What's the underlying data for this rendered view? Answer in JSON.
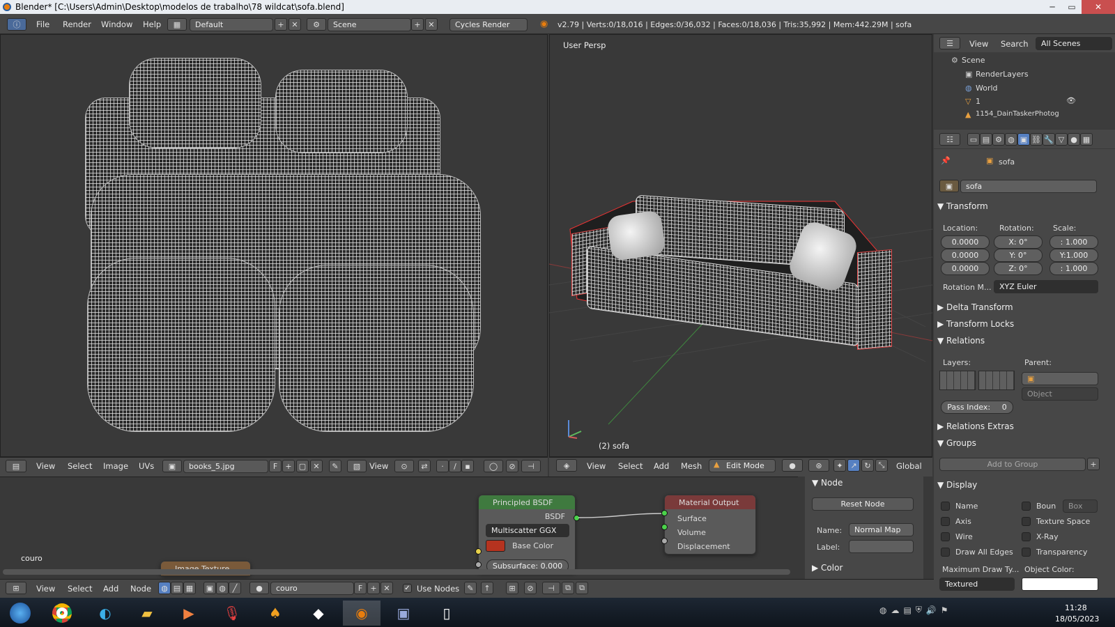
{
  "window": {
    "title": "Blender* [C:\\Users\\Admin\\Desktop\\modelos de trabalho\\78 wildcat\\sofa.blend]",
    "minimize": "─",
    "maximize": "▭",
    "close": "✕"
  },
  "menubar": {
    "items": [
      "File",
      "Render",
      "Window",
      "Help"
    ],
    "screen_layout": "Default",
    "scene": "Scene",
    "render_engine": "Cycles Render",
    "stats": "v2.79 | Verts:0/18,016 | Edges:0/36,032 | Faces:0/18,036 | Tris:35,992 | Mem:442.29M | sofa"
  },
  "uv_editor": {
    "menu": [
      "View",
      "Select",
      "Image",
      "UVs"
    ],
    "image_name": "books_5.jpg",
    "f_label": "F",
    "view_label": "View"
  },
  "viewport3d": {
    "view_name": "User Persp",
    "object_label": "(2) sofa",
    "menu": [
      "View",
      "Select",
      "Add",
      "Mesh"
    ],
    "mode": "Edit Mode",
    "orientation": "Global"
  },
  "outliner": {
    "menu": [
      "View",
      "Search"
    ],
    "filter": "All Scenes",
    "items": [
      "Scene",
      "RenderLayers",
      "World",
      "1",
      "1154_DainTaskerPhotog"
    ]
  },
  "properties": {
    "breadcrumb": "sofa",
    "object_name": "sofa",
    "transform": {
      "title": "Transform",
      "location_label": "Location:",
      "rotation_label": "Rotation:",
      "scale_label": "Scale:",
      "location": [
        "0.0000",
        "0.0000",
        "0.0000"
      ],
      "rotation": [
        "X:      0°",
        "Y:      0°",
        "Z:      0°"
      ],
      "scale": [
        ":  1.000",
        "Y:1.000",
        ":  1.000"
      ],
      "rotation_mode_label": "Rotation M...",
      "rotation_mode": "XYZ Euler"
    },
    "delta_transform": "Delta Transform",
    "transform_locks": "Transform Locks",
    "relations": {
      "title": "Relations",
      "layers_label": "Layers:",
      "parent_label": "Parent:",
      "parent_type": "Object",
      "pass_index_label": "Pass Index:",
      "pass_index": "0"
    },
    "relations_extras": "Relations Extras",
    "groups": {
      "title": "Groups",
      "add": "Add to Group"
    },
    "display": {
      "title": "Display",
      "left": [
        "Name",
        "Axis",
        "Wire",
        "Draw All Edges"
      ],
      "right": [
        "Boun",
        "Texture Space",
        "X-Ray",
        "Transparency"
      ],
      "bounds_type": "Box",
      "max_draw_label": "Maximum Draw Ty...",
      "max_draw": "Textured",
      "object_color_label": "Object Color:"
    }
  },
  "node_editor": {
    "material_label": "couro",
    "image_texture_node": "Image Texture",
    "principled": {
      "title": "Principled BSDF",
      "output": "BSDF",
      "distribution": "Multiscatter GGX",
      "base_color": "Base Color",
      "subsurface": "Subsurface: 0.000"
    },
    "material_output": {
      "title": "Material Output",
      "inputs": [
        "Surface",
        "Volume",
        "Displacement"
      ]
    },
    "side_panel": {
      "node_title": "Node",
      "reset": "Reset Node",
      "name_label": "Name:",
      "name_value": "Normal Map",
      "label_label": "Label:",
      "color_title": "Color"
    },
    "footer": {
      "menu": [
        "View",
        "Select",
        "Add",
        "Node"
      ],
      "material": "couro",
      "f_label": "F",
      "use_nodes": "Use Nodes"
    }
  },
  "taskbar": {
    "time": "11:28",
    "date": "18/05/2023"
  },
  "colors": {
    "base_color_swatch": "#b5331f",
    "blender_orange": "#e87d0d",
    "active_blue": "#5680c2"
  }
}
